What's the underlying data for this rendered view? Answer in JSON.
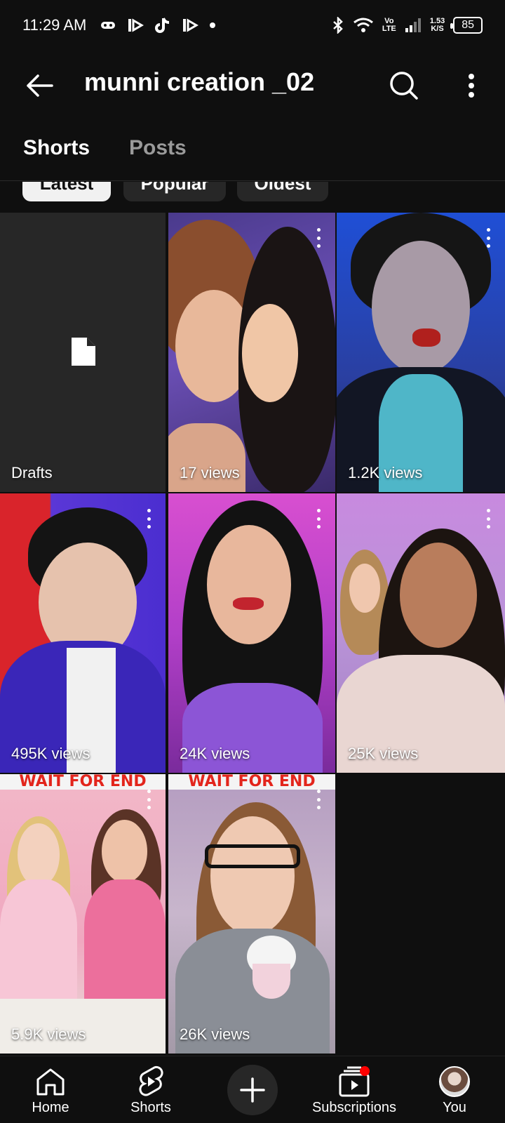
{
  "status_bar": {
    "time": "11:29 AM",
    "network_top": "Vo",
    "network_bottom": "LTE",
    "speed_value": "1.53",
    "speed_unit": "K/S",
    "battery": "85"
  },
  "header": {
    "title": "munni creation _02"
  },
  "tabs": [
    {
      "label": "Shorts",
      "active": true
    },
    {
      "label": "Posts",
      "active": false
    }
  ],
  "filters": [
    {
      "label": "Latest",
      "selected": true
    },
    {
      "label": "Popular",
      "selected": false
    },
    {
      "label": "Oldest",
      "selected": false
    }
  ],
  "grid": {
    "drafts_label": "Drafts",
    "items": [
      {
        "views": "17 views"
      },
      {
        "views": "1.2K views"
      },
      {
        "views": "495K views"
      },
      {
        "views": "24K views"
      },
      {
        "views": "25K views"
      },
      {
        "views": "5.9K views",
        "banner": "WAIT FOR END"
      },
      {
        "views": "26K views",
        "banner": "WAIT FOR END"
      }
    ]
  },
  "bottom_nav": {
    "home": "Home",
    "shorts": "Shorts",
    "subscriptions": "Subscriptions",
    "you": "You"
  },
  "colors": {
    "background": "#0f0f0f",
    "chip_selected": "#f1f1f1",
    "chip_unselected": "#272727",
    "notification_dot": "#ff0000"
  }
}
